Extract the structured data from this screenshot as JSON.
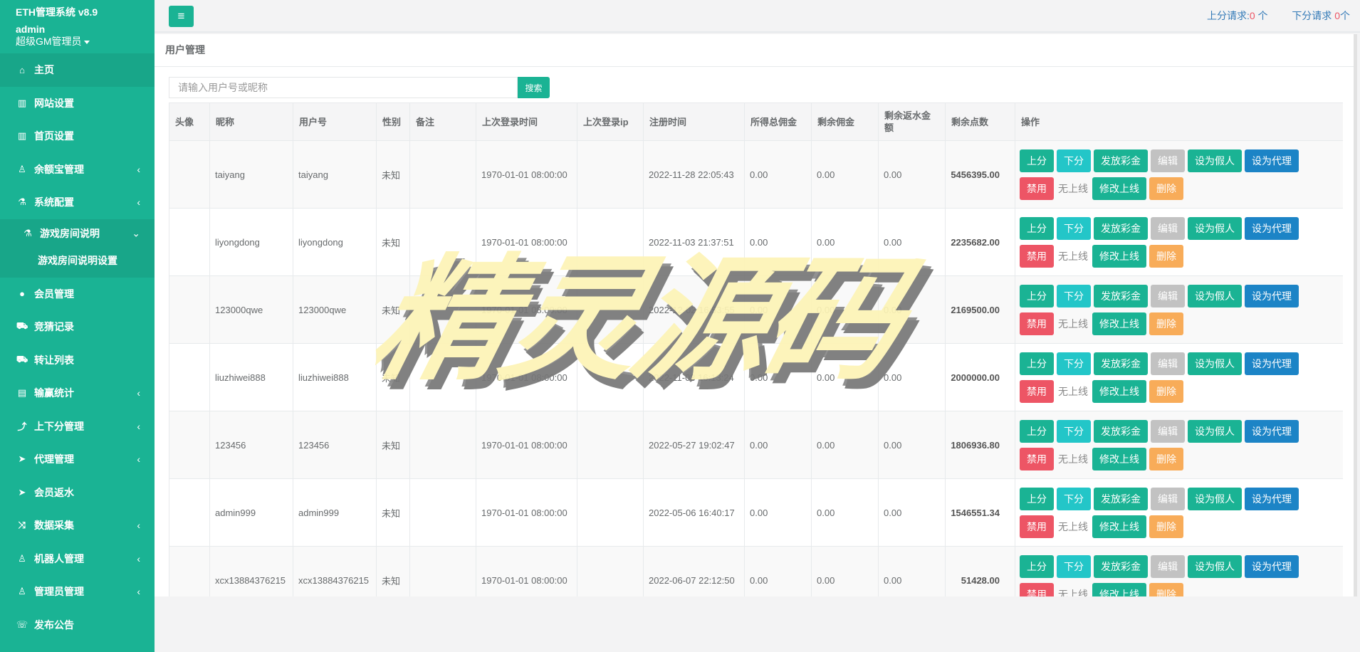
{
  "brand": {
    "title": "ETH管理系统 v8.9",
    "user": "admin",
    "role": "超级GM管理员"
  },
  "sidebar": {
    "items": [
      {
        "label": "主页",
        "icon": "home-icon",
        "glyph": "⌂",
        "active": true
      },
      {
        "label": "网站设置",
        "icon": "columns-icon",
        "glyph": "▥"
      },
      {
        "label": "首页设置",
        "icon": "columns-icon",
        "glyph": "▥"
      },
      {
        "label": "余额宝管理",
        "icon": "person-icon",
        "glyph": "♙",
        "arrow": "‹"
      },
      {
        "label": "系统配置",
        "icon": "flask-icon",
        "glyph": "⚗",
        "arrow": "‹"
      },
      {
        "label": "游戏房间说明",
        "icon": "flask-icon",
        "glyph": "⚗",
        "arrow": "⌄"
      },
      {
        "label": "游戏房间说明设置"
      },
      {
        "label": "会员管理",
        "icon": "user-icon",
        "glyph": "●"
      },
      {
        "label": "竞猜记录",
        "icon": "car-icon",
        "glyph": "⛟"
      },
      {
        "label": "转让列表",
        "icon": "car-icon",
        "glyph": "⛟"
      },
      {
        "label": "输赢统计",
        "icon": "bar-chart-icon",
        "glyph": "▤",
        "arrow": "‹"
      },
      {
        "label": "上下分管理",
        "icon": "level-up-icon",
        "glyph": "⤴",
        "arrow": "‹"
      },
      {
        "label": "代理管理",
        "icon": "paper-plane-icon",
        "glyph": "➤",
        "arrow": "‹"
      },
      {
        "label": "会员返水",
        "icon": "paper-plane-icon",
        "glyph": "➤"
      },
      {
        "label": "数据采集",
        "icon": "random-icon",
        "glyph": "⤨",
        "arrow": "‹"
      },
      {
        "label": "机器人管理",
        "icon": "robot-icon",
        "glyph": "♙",
        "arrow": "‹"
      },
      {
        "label": "管理员管理",
        "icon": "person-icon",
        "glyph": "♙",
        "arrow": "‹"
      },
      {
        "label": "发布公告",
        "icon": "comment-icon",
        "glyph": "☏"
      }
    ]
  },
  "topbar": {
    "menu_icon": "≡",
    "up_label": "上分请求:",
    "up_count": "0",
    "up_unit": "个",
    "down_label": "下分请求",
    "down_count": "0",
    "down_unit": "个"
  },
  "page": {
    "title": "用户管理"
  },
  "search": {
    "placeholder": "请输入用户号或昵称",
    "button": "搜索"
  },
  "table": {
    "columns": [
      "头像",
      "昵称",
      "用户号",
      "性别",
      "备注",
      "上次登录时间",
      "上次登录ip",
      "注册时间",
      "所得总佣金",
      "剩余佣金",
      "剩余返水金额",
      "剩余点数",
      "操作"
    ],
    "rows": [
      {
        "nick": "taiyang",
        "uid": "taiyang",
        "sex": "未知",
        "note": "",
        "last_login": "1970-01-01 08:00:00",
        "ip": "",
        "reg": "2022-11-28 22:05:43",
        "total": "0.00",
        "remain": "0.00",
        "rebate": "0.00",
        "points": "5456395.00"
      },
      {
        "nick": "liyongdong",
        "uid": "liyongdong",
        "sex": "未知",
        "note": "",
        "last_login": "1970-01-01 08:00:00",
        "ip": "",
        "reg": "2022-11-03 21:37:51",
        "total": "0.00",
        "remain": "0.00",
        "rebate": "0.00",
        "points": "2235682.00"
      },
      {
        "nick": "123000qwe",
        "uid": "123000qwe",
        "sex": "未知",
        "note": "",
        "last_login": "1970-01-01 08:00:00",
        "ip": "",
        "reg": "2022-12-02 16:53:55",
        "total": "0.00",
        "remain": "0.00",
        "rebate": "0.00",
        "points": "2169500.00"
      },
      {
        "nick": "liuzhiwei888",
        "uid": "liuzhiwei888",
        "sex": "未知",
        "note": "",
        "last_login": "1970-01-01 08:00:00",
        "ip": "",
        "reg": "2022-11-03 16:13:24",
        "total": "0.00",
        "remain": "0.00",
        "rebate": "0.00",
        "points": "2000000.00"
      },
      {
        "nick": "123456",
        "uid": "123456",
        "sex": "未知",
        "note": "",
        "last_login": "1970-01-01 08:00:00",
        "ip": "",
        "reg": "2022-05-27 19:02:47",
        "total": "0.00",
        "remain": "0.00",
        "rebate": "0.00",
        "points": "1806936.80"
      },
      {
        "nick": "admin999",
        "uid": "admin999",
        "sex": "未知",
        "note": "",
        "last_login": "1970-01-01 08:00:00",
        "ip": "",
        "reg": "2022-05-06 16:40:17",
        "total": "0.00",
        "remain": "0.00",
        "rebate": "0.00",
        "points": "1546551.34"
      },
      {
        "nick": "xcx13884376215",
        "uid": "xcx13884376215",
        "sex": "未知",
        "note": "",
        "last_login": "1970-01-01 08:00:00",
        "ip": "",
        "reg": "2022-06-07 22:12:50",
        "total": "0.00",
        "remain": "0.00",
        "rebate": "0.00",
        "points": "51428.00"
      }
    ],
    "actions": {
      "up": "上分",
      "down": "下分",
      "bonus": "发放彩金",
      "edit": "编辑",
      "fake": "设为假人",
      "agent": "设为代理",
      "ban": "禁用",
      "status": "无上线",
      "set_upline": "修改上线",
      "delete": "删除"
    }
  },
  "watermark": "精灵源码",
  "colors": {
    "sidebar": "#1ab394",
    "primary": "#1ab394",
    "info": "#23c6c8",
    "success_blue": "#1c84c6",
    "danger": "#ed5565",
    "warning": "#f8ac59",
    "muted": "#c2c2c2"
  }
}
